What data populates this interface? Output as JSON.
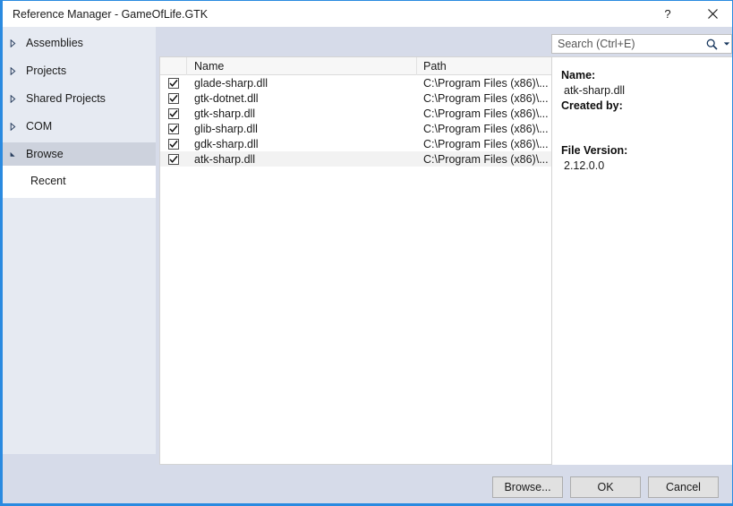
{
  "window": {
    "title": "Reference Manager - GameOfLife.GTK",
    "accent_color": "#2a8ae0",
    "chrome_bg": "#d6dbe9",
    "help_label": "?",
    "close_icon": "close-icon"
  },
  "sidebar": {
    "items": [
      {
        "label": "Assemblies",
        "state": "collapsed",
        "selected": false
      },
      {
        "label": "Projects",
        "state": "collapsed",
        "selected": false
      },
      {
        "label": "Shared Projects",
        "state": "collapsed",
        "selected": false
      },
      {
        "label": "COM",
        "state": "collapsed",
        "selected": false
      },
      {
        "label": "Browse",
        "state": "expanded",
        "selected": true
      }
    ],
    "subitems": [
      {
        "label": "Recent",
        "selected": false
      }
    ]
  },
  "search": {
    "placeholder": "Search (Ctrl+E)",
    "value": "",
    "icon": "magnifier-icon",
    "dropdown_icon": "chevron-down-icon"
  },
  "list": {
    "columns": [
      "",
      "Name",
      "Path"
    ],
    "rows": [
      {
        "checked": true,
        "name": "glade-sharp.dll",
        "path": "C:\\Program Files (x86)\\...",
        "selected": false
      },
      {
        "checked": true,
        "name": "gtk-dotnet.dll",
        "path": "C:\\Program Files (x86)\\...",
        "selected": false
      },
      {
        "checked": true,
        "name": "gtk-sharp.dll",
        "path": "C:\\Program Files (x86)\\...",
        "selected": false
      },
      {
        "checked": true,
        "name": "glib-sharp.dll",
        "path": "C:\\Program Files (x86)\\...",
        "selected": false
      },
      {
        "checked": true,
        "name": "gdk-sharp.dll",
        "path": "C:\\Program Files (x86)\\...",
        "selected": false
      },
      {
        "checked": true,
        "name": "atk-sharp.dll",
        "path": "C:\\Program Files (x86)\\...",
        "selected": true
      }
    ]
  },
  "details": {
    "name_label": "Name:",
    "name_value": "atk-sharp.dll",
    "created_by_label": "Created by:",
    "created_by_value": "",
    "file_version_label": "File Version:",
    "file_version_value": "2.12.0.0"
  },
  "footer": {
    "browse_label": "Browse...",
    "ok_label": "OK",
    "cancel_label": "Cancel"
  }
}
